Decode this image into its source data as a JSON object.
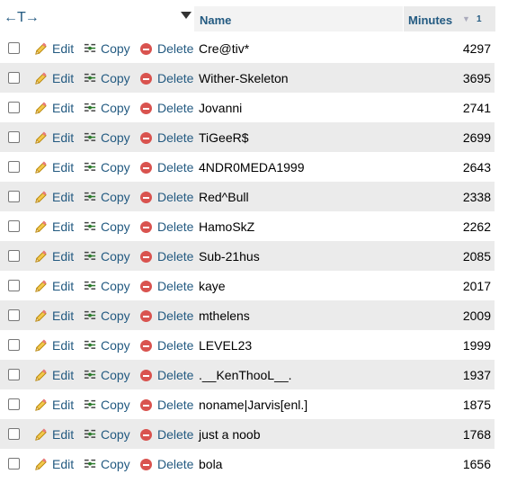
{
  "header": {
    "arrows": "←T→",
    "name_label": "Name",
    "minutes_label": "Minutes",
    "sort_order": "1"
  },
  "actions": {
    "edit": "Edit",
    "copy": "Copy",
    "delete": "Delete"
  },
  "rows": [
    {
      "name": "Cre@tiv*",
      "minutes": "4297"
    },
    {
      "name": "Wither-Skeleton",
      "minutes": "3695"
    },
    {
      "name": "Jovanni",
      "minutes": "2741"
    },
    {
      "name": "TiGeeR$",
      "minutes": "2699"
    },
    {
      "name": "4NDR0MEDA1999",
      "minutes": "2643"
    },
    {
      "name": "Red^Bull",
      "minutes": "2338"
    },
    {
      "name": "HamoSkZ",
      "minutes": "2262"
    },
    {
      "name": "Sub-21hus",
      "minutes": "2085"
    },
    {
      "name": "kaye",
      "minutes": "2017"
    },
    {
      "name": "mthelens",
      "minutes": "2009"
    },
    {
      "name": "LEVEL23",
      "minutes": "1999"
    },
    {
      "name": ".__KenThooL__.",
      "minutes": "1937"
    },
    {
      "name": "noname|Jarvis[enl.]",
      "minutes": "1875"
    },
    {
      "name": "just a noob",
      "minutes": "1768"
    },
    {
      "name": "bola",
      "minutes": "1656"
    }
  ],
  "colors": {
    "link": "#235a81",
    "row_alt": "#ebebeb",
    "delete_icon": "#d9534f"
  }
}
